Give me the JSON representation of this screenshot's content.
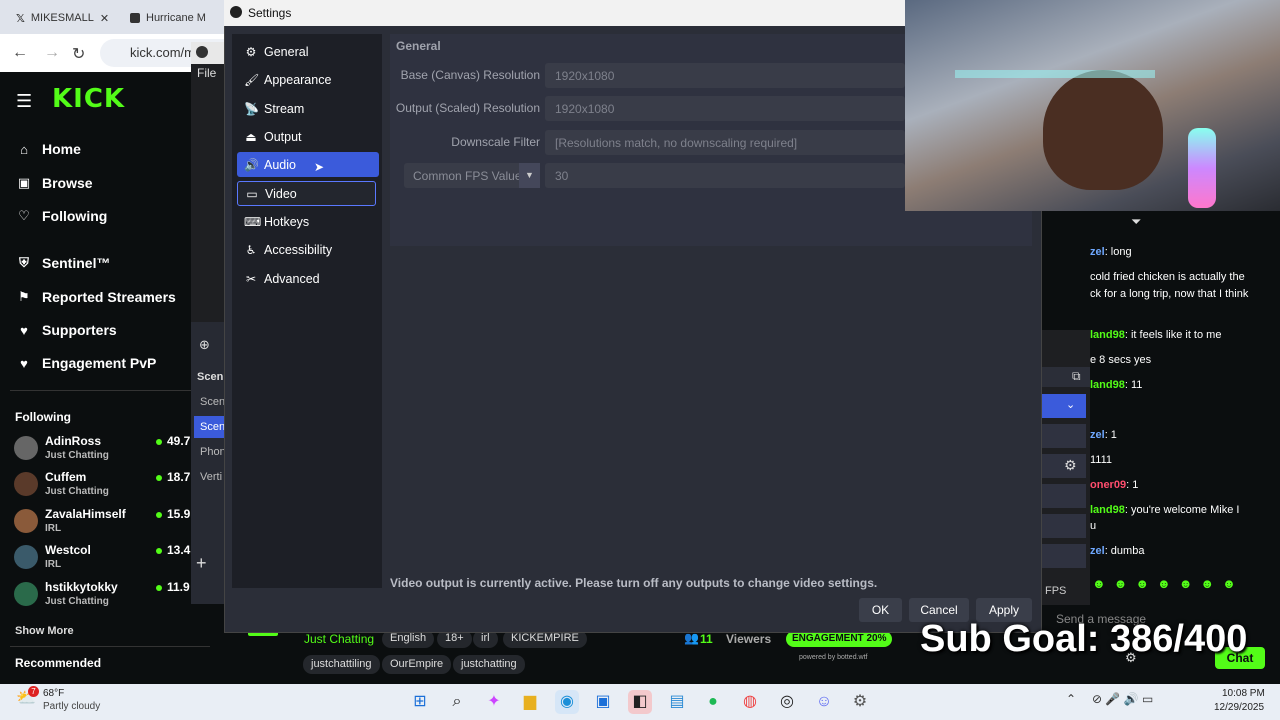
{
  "browser": {
    "tabs": [
      {
        "label": "MIKESMALL",
        "icon": "x-logo-icon"
      },
      {
        "label": "Hurricane M",
        "icon": "tab-icon"
      }
    ],
    "address": "kick.com/m"
  },
  "kick": {
    "logo": "KICK",
    "menu": [
      {
        "label": "Home",
        "icon": "home-icon"
      },
      {
        "label": "Browse",
        "icon": "browse-icon"
      },
      {
        "label": "Following",
        "icon": "heart-icon"
      },
      {
        "label": "Sentinel™",
        "icon": "shield-icon"
      },
      {
        "label": "Reported Streamers",
        "icon": "flag-icon"
      },
      {
        "label": "Supporters",
        "icon": "heart-icon"
      },
      {
        "label": "Engagement PvP",
        "icon": "pvp-icon"
      }
    ],
    "following_header": "Following",
    "following": [
      {
        "name": "AdinRoss",
        "category": "Just Chatting",
        "viewers": "49.7"
      },
      {
        "name": "Cuffem",
        "category": "Just Chatting",
        "viewers": "18.7"
      },
      {
        "name": "ZavalaHimself",
        "category": "IRL",
        "viewers": "15.9"
      },
      {
        "name": "Westcol",
        "category": "IRL",
        "viewers": "13.4"
      },
      {
        "name": "hstikkytokky",
        "category": "Just Chatting",
        "viewers": "11.9"
      }
    ],
    "show_more": "Show More",
    "recommended": "Recommended",
    "stream": {
      "category": "Just Chatting",
      "tags1": [
        "English",
        "18+",
        "irl",
        "KICKEMPIRE"
      ],
      "tags2": [
        "justchattiling",
        "OurEmpire",
        "justchatting"
      ],
      "viewers_count": "11",
      "viewers_label": "Viewers",
      "engagement": "ENGAGEMENT 20%",
      "powered": "powered by botted.wtf"
    }
  },
  "obs": {
    "file_menu": "File",
    "scene_header": "Scen",
    "scenes": [
      "Scen",
      "Scen",
      "Phon",
      "Verti"
    ],
    "fps_label": "FPS",
    "add": "+"
  },
  "settings": {
    "title": "Settings",
    "sidebar": [
      {
        "label": "General",
        "icon": "gear-icon"
      },
      {
        "label": "Appearance",
        "icon": "appearance-icon"
      },
      {
        "label": "Stream",
        "icon": "antenna-icon"
      },
      {
        "label": "Output",
        "icon": "output-icon"
      },
      {
        "label": "Audio",
        "icon": "speaker-icon"
      },
      {
        "label": "Video",
        "icon": "monitor-icon"
      },
      {
        "label": "Hotkeys",
        "icon": "keyboard-icon"
      },
      {
        "label": "Accessibility",
        "icon": "accessibility-icon"
      },
      {
        "label": "Advanced",
        "icon": "tools-icon"
      }
    ],
    "section_title": "General",
    "fields": [
      {
        "label": "Base (Canvas) Resolution",
        "value": "1920x1080"
      },
      {
        "label": "Output (Scaled) Resolution",
        "value": "1920x1080"
      },
      {
        "label": "Downscale Filter",
        "value": "[Resolutions match, no downscaling required]"
      }
    ],
    "fps_dropdown": "Common FPS Values",
    "fps_value": "30",
    "warning": "Video output is currently active. Please turn off any outputs to change video settings.",
    "buttons": {
      "ok": "OK",
      "cancel": "Cancel",
      "apply": "Apply"
    }
  },
  "chat": {
    "messages": [
      {
        "user": "zel",
        "text": ": long",
        "color": "#6fa8ff"
      },
      {
        "user": "",
        "text": "cold fried chicken is actually the",
        "color": "#ffffff"
      },
      {
        "user": "",
        "text": "ck for a long trip, now that I think",
        "color": "#ffffff"
      },
      {
        "user": "land98",
        "text": ": it feels like it to me",
        "color": "#53fc18"
      },
      {
        "user": "",
        "text": "e 8 secs yes",
        "color": "#ffffff"
      },
      {
        "user": "land98",
        "text": ": 11",
        "color": "#53fc18"
      },
      {
        "user": "zel",
        "text": ": 1",
        "color": "#6fa8ff"
      },
      {
        "user": "",
        "text": "1111",
        "color": "#ffffff"
      },
      {
        "user": "oner09",
        "text": ": 1",
        "color": "#ff4d6d"
      },
      {
        "user": "land98",
        "text": ": you're welcome Mike I",
        "color": "#53fc18"
      },
      {
        "user": "",
        "text": "u",
        "color": "#ffffff"
      },
      {
        "user": "zel",
        "text": ": dumba",
        "color": "#6fa8ff"
      }
    ],
    "send_placeholder": "Send a message",
    "chat_button": "Chat"
  },
  "overlay": {
    "sub_goal": "Sub Goal: 386/400"
  },
  "taskbar": {
    "weather_temp": "68°F",
    "weather_desc": "Partly cloudy",
    "weather_badge": "7",
    "time": "10:08 PM",
    "date": "12/29/2025",
    "icons": [
      "windows-icon",
      "search-icon",
      "copilot-icon",
      "folder-icon",
      "edge-icon",
      "store-icon",
      "app-icon",
      "photos-icon",
      "spotify-icon",
      "chrome-icon",
      "obs-icon",
      "discord-icon",
      "settings-icon"
    ]
  },
  "colors": {
    "kick_green": "#53fc18",
    "obs_accent": "#3b5bdb"
  }
}
